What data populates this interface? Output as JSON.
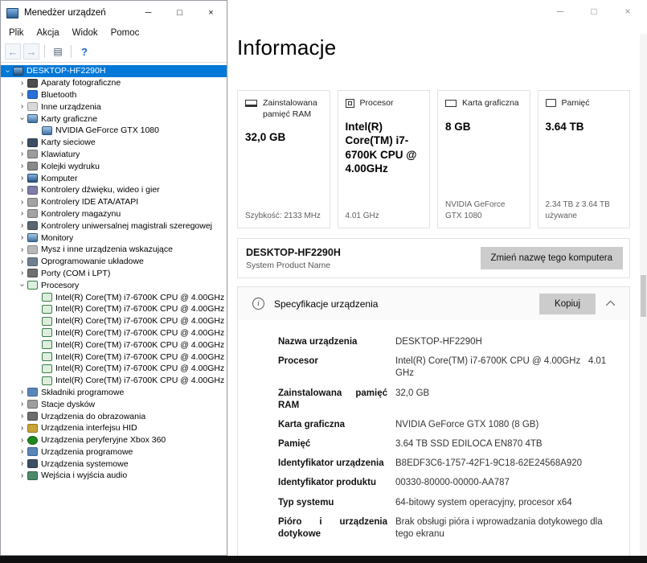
{
  "colors": {
    "accent_selection": "#0078d7",
    "button_gray": "#cccccc",
    "taskbar": "#101010"
  },
  "device_manager": {
    "window_title": "Menedżer urządzeń",
    "window_controls": {
      "minimize": "─",
      "maximize": "□",
      "close": "×"
    },
    "menu_items": [
      "Plik",
      "Akcja",
      "Widok",
      "Pomoc"
    ],
    "toolbar_icons": [
      "back-arrow",
      "forward-arrow",
      "separator",
      "list-view",
      "separator",
      "help"
    ],
    "tree": {
      "items": [
        {
          "label": "DESKTOP-HF2290H",
          "level": 0,
          "expand": "expanded",
          "icon": "computer",
          "selected": true
        },
        {
          "label": "Aparaty fotograficzne",
          "level": 1,
          "expand": "collapsed",
          "icon": "camera"
        },
        {
          "label": "Bluetooth",
          "level": 1,
          "expand": "collapsed",
          "icon": "bluetooth"
        },
        {
          "label": "Inne urządzenia",
          "level": 1,
          "expand": "collapsed",
          "icon": "unknown-device"
        },
        {
          "label": "Karty graficzne",
          "level": 1,
          "expand": "expanded",
          "icon": "display-adapter"
        },
        {
          "label": "NVIDIA GeForce GTX 1080",
          "level": 2,
          "icon": "display-adapter"
        },
        {
          "label": "Karty sieciowe",
          "level": 1,
          "expand": "collapsed",
          "icon": "network-adapter"
        },
        {
          "label": "Klawiatury",
          "level": 1,
          "expand": "collapsed",
          "icon": "keyboard"
        },
        {
          "label": "Kolejki wydruku",
          "level": 1,
          "expand": "collapsed",
          "icon": "printer"
        },
        {
          "label": "Komputer",
          "level": 1,
          "expand": "collapsed",
          "icon": "computer"
        },
        {
          "label": "Kontrolery dźwięku, wideo i gier",
          "level": 1,
          "expand": "collapsed",
          "icon": "sound-controller"
        },
        {
          "label": "Kontrolery IDE ATA/ATAPI",
          "level": 1,
          "expand": "collapsed",
          "icon": "ide-controller"
        },
        {
          "label": "Kontrolery magazynu",
          "level": 1,
          "expand": "collapsed",
          "icon": "storage-controller"
        },
        {
          "label": "Kontrolery uniwersalnej magistrali szeregowej",
          "level": 1,
          "expand": "collapsed",
          "icon": "usb-controller"
        },
        {
          "label": "Monitory",
          "level": 1,
          "expand": "collapsed",
          "icon": "monitor"
        },
        {
          "label": "Mysz i inne urządzenia wskazujące",
          "level": 1,
          "expand": "collapsed",
          "icon": "mouse"
        },
        {
          "label": "Oprogramowanie układowe",
          "level": 1,
          "expand": "collapsed",
          "icon": "firmware"
        },
        {
          "label": "Porty (COM i LPT)",
          "level": 1,
          "expand": "collapsed",
          "icon": "port"
        },
        {
          "label": "Procesory",
          "level": 1,
          "expand": "expanded",
          "icon": "processor"
        },
        {
          "label": "Intel(R) Core(TM) i7-6700K CPU @ 4.00GHz",
          "level": 2,
          "icon": "processor"
        },
        {
          "label": "Intel(R) Core(TM) i7-6700K CPU @ 4.00GHz",
          "level": 2,
          "icon": "processor"
        },
        {
          "label": "Intel(R) Core(TM) i7-6700K CPU @ 4.00GHz",
          "level": 2,
          "icon": "processor"
        },
        {
          "label": "Intel(R) Core(TM) i7-6700K CPU @ 4.00GHz",
          "level": 2,
          "icon": "processor"
        },
        {
          "label": "Intel(R) Core(TM) i7-6700K CPU @ 4.00GHz",
          "level": 2,
          "icon": "processor"
        },
        {
          "label": "Intel(R) Core(TM) i7-6700K CPU @ 4.00GHz",
          "level": 2,
          "icon": "processor"
        },
        {
          "label": "Intel(R) Core(TM) i7-6700K CPU @ 4.00GHz",
          "level": 2,
          "icon": "processor"
        },
        {
          "label": "Intel(R) Core(TM) i7-6700K CPU @ 4.00GHz",
          "level": 2,
          "icon": "processor"
        },
        {
          "label": "Składniki programowe",
          "level": 1,
          "expand": "collapsed",
          "icon": "software-component"
        },
        {
          "label": "Stacje dysków",
          "level": 1,
          "expand": "collapsed",
          "icon": "disk-drive"
        },
        {
          "label": "Urządzenia do obrazowania",
          "level": 1,
          "expand": "collapsed",
          "icon": "imaging-device"
        },
        {
          "label": "Urządzenia interfejsu HID",
          "level": 1,
          "expand": "collapsed",
          "icon": "hid-device"
        },
        {
          "label": "Urządzenia peryferyjne Xbox 360",
          "level": 1,
          "expand": "collapsed",
          "icon": "xbox-peripheral"
        },
        {
          "label": "Urządzenia programowe",
          "level": 1,
          "expand": "collapsed",
          "icon": "software-device"
        },
        {
          "label": "Urządzenia systemowe",
          "level": 1,
          "expand": "collapsed",
          "icon": "system-device"
        },
        {
          "label": "Wejścia i wyjścia audio",
          "level": 1,
          "expand": "collapsed",
          "icon": "audio-device"
        }
      ]
    }
  },
  "settings": {
    "page_title": "Informacje",
    "window_controls": {
      "minimize": "─",
      "maximize": "□",
      "close": "×"
    },
    "cards": [
      {
        "icon": "ram",
        "label": "Zainstalowana pamięć RAM",
        "value": "32,0 GB",
        "footer": "Szybkość: 2133 MHz"
      },
      {
        "icon": "cpu",
        "label": "Procesor",
        "value": "Intel(R) Core(TM) i7-6700K CPU @ 4.00GHz",
        "footer": "4.01 GHz"
      },
      {
        "icon": "gpu",
        "label": "Karta graficzna",
        "value": "8 GB",
        "footer": "NVIDIA GeForce GTX 1080"
      },
      {
        "icon": "storage",
        "label": "Pamięć",
        "value": "3.64 TB",
        "footer": "2.34 TB z 3.64 TB używane"
      }
    ],
    "computer": {
      "name": "DESKTOP-HF2290H",
      "subtitle": "System Product Name",
      "rename_button": "Zmień nazwę tego komputera"
    },
    "spec_header": {
      "title": "Specyfikacje urządzenia",
      "copy_button": "Kopiuj"
    },
    "specs": [
      {
        "label": "Nazwa urządzenia",
        "value": "DESKTOP-HF2290H"
      },
      {
        "label": "Procesor",
        "value": "Intel(R) Core(TM) i7-6700K CPU @ 4.00GHz   4.01 GHz"
      },
      {
        "label": "Zainstalowana pamięć RAM",
        "value": "32,0 GB"
      },
      {
        "label": "Karta graficzna",
        "value": "NVIDIA GeForce GTX 1080 (8 GB)"
      },
      {
        "label": "Pamięć",
        "value": "3.64 TB SSD EDILOCA EN870 4TB"
      },
      {
        "label": "Identyfikator urządzenia",
        "value": "B8EDF3C6-1757-42F1-9C18-62E24568A920"
      },
      {
        "label": "Identyfikator produktu",
        "value": "00330-80000-00000-AA787"
      },
      {
        "label": "Typ systemu",
        "value": "64-bitowy system operacyjny, procesor x64"
      },
      {
        "label": "Pióro i urządzenia dotykowe",
        "value": "Brak obsługi pióra i wprowadzania dotykowego dla tego ekranu"
      }
    ]
  }
}
